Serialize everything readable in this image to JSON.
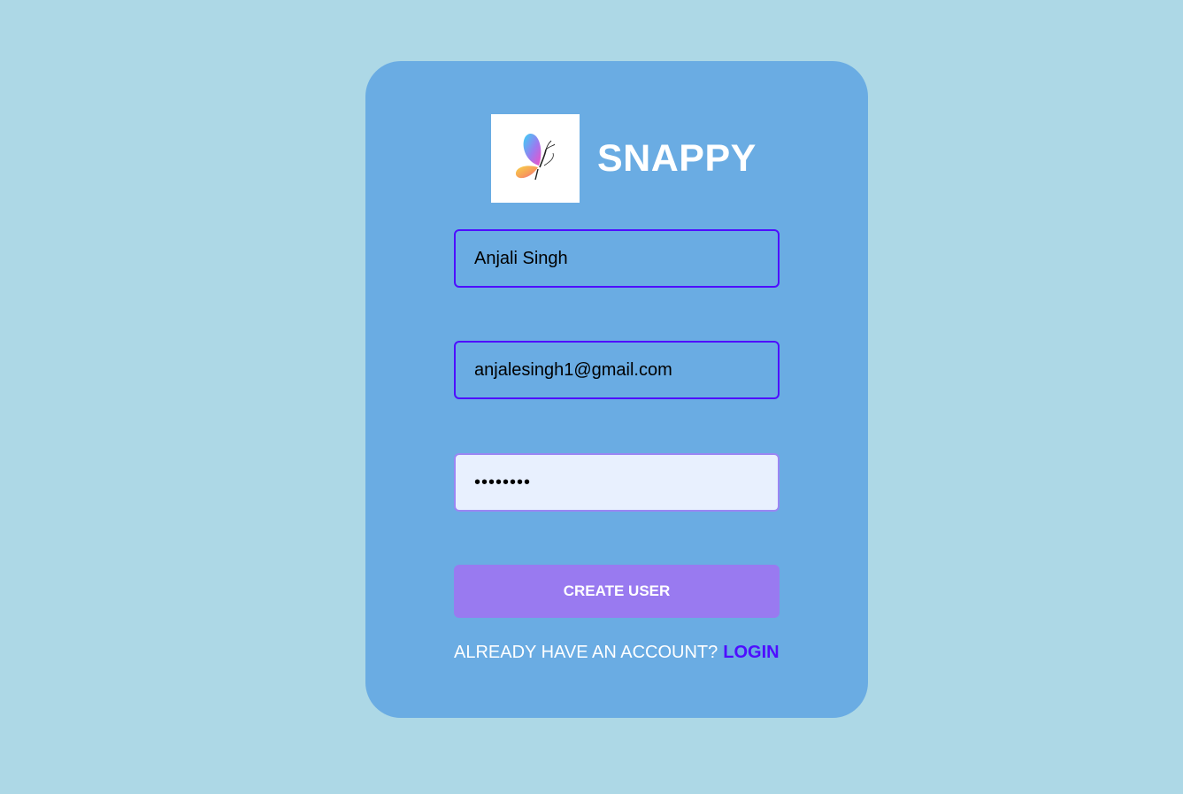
{
  "brand": {
    "logo_icon": "butterfly-logo-icon",
    "name": "SNAPPY"
  },
  "form": {
    "username": {
      "value": "Anjali Singh"
    },
    "email": {
      "value": "anjalesingh1@gmail.com"
    },
    "password": {
      "value": "••••••••"
    },
    "submit_label": "CREATE USER"
  },
  "footer": {
    "prompt": "ALREADY HAVE AN ACCOUNT?",
    "link_label": "LOGIN"
  },
  "colors": {
    "page_background": "#add8e6",
    "card_background": "#6aace3",
    "accent": "#4e0eff",
    "button": "#997af0",
    "autofill_background": "#e8f0fe"
  }
}
